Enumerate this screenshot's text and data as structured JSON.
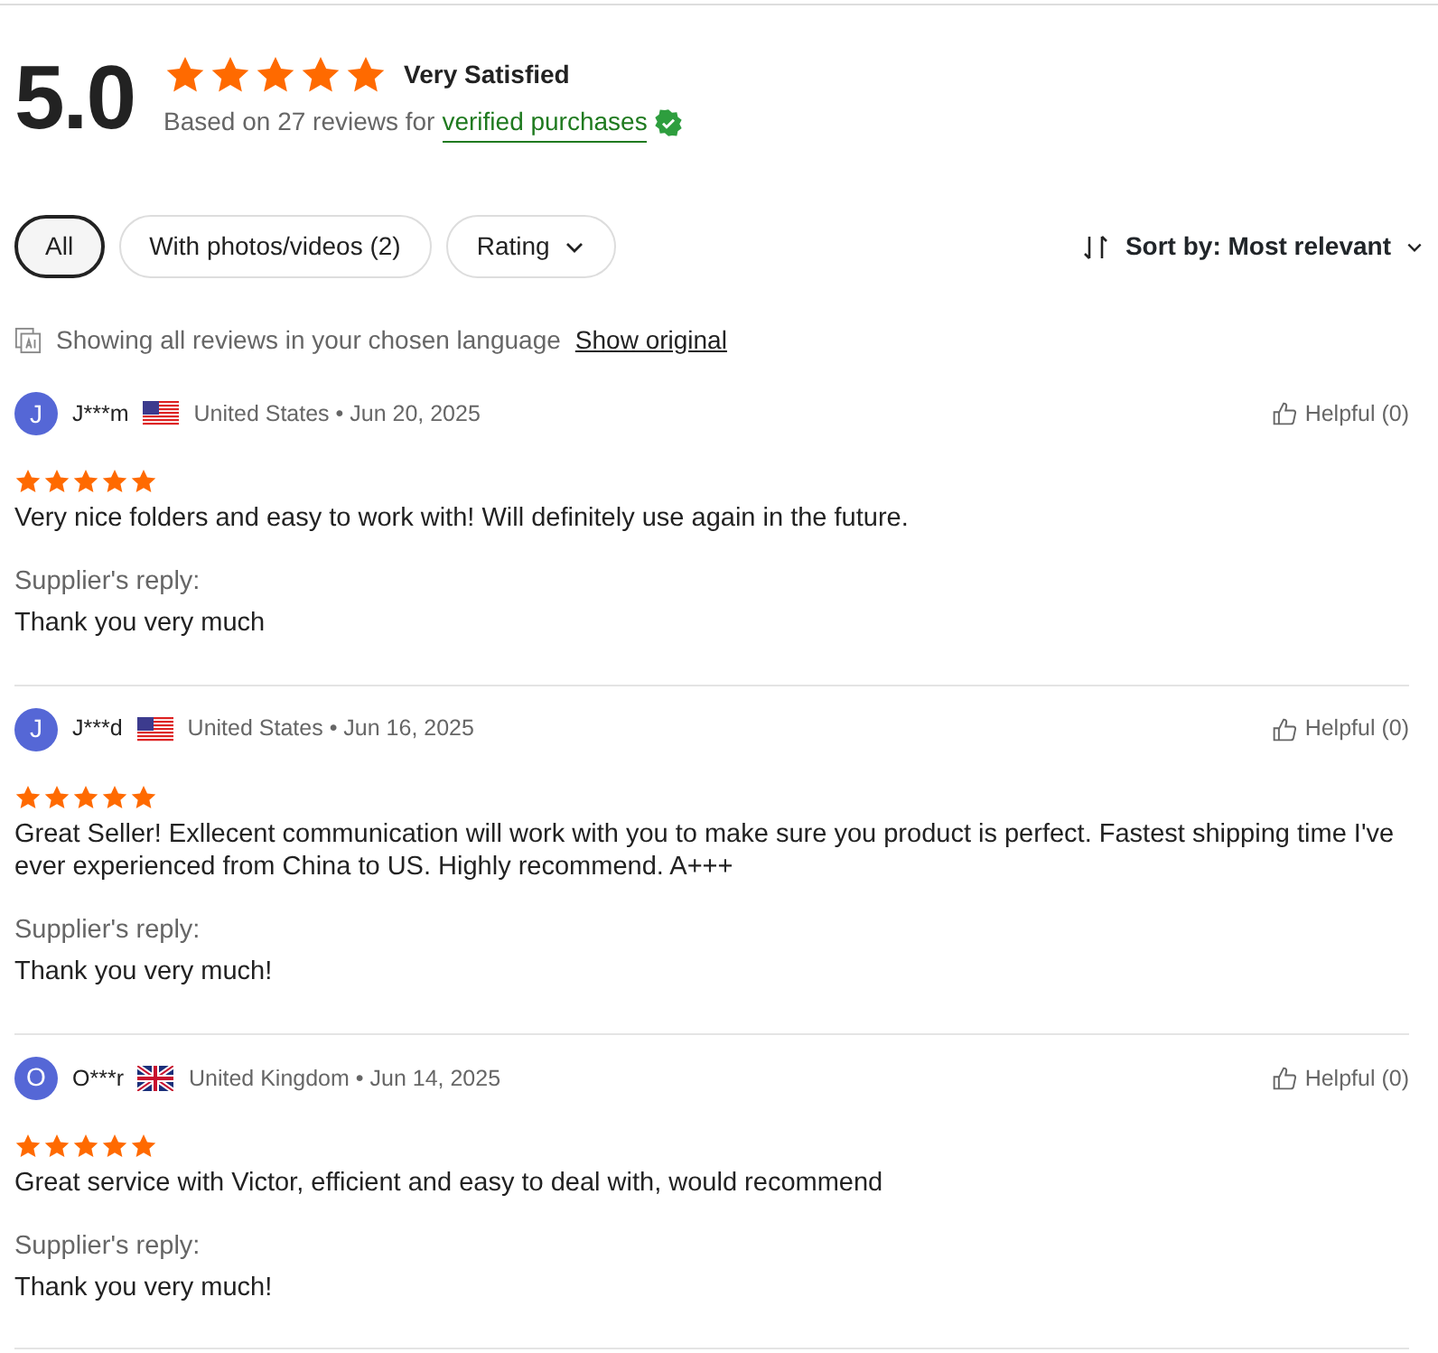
{
  "summary": {
    "score": "5.0",
    "stars": 5,
    "label": "Very Satisfied",
    "based_on": "Based on 27 reviews for",
    "verified_link": "verified purchases"
  },
  "filters": [
    {
      "label": "All",
      "selected": true,
      "kind": "chip"
    },
    {
      "label": "With photos/videos (2)",
      "selected": false,
      "kind": "chip"
    },
    {
      "label": "Rating",
      "selected": false,
      "kind": "dropdown"
    }
  ],
  "sort": {
    "label": "Sort by: Most relevant"
  },
  "translation": {
    "text": "Showing all reviews in your chosen language",
    "link": "Show original"
  },
  "reviews": [
    {
      "initial": "J",
      "name": "J***m",
      "kind": "us",
      "country": "United States",
      "separator": "•",
      "date": "Jun 20, 2025",
      "helpful": "Helpful (0)",
      "stars": 5,
      "text": "Very nice folders and easy to work with! Will definitely use again in the future.",
      "reply_label": "Supplier's reply:",
      "reply": "Thank you very much"
    },
    {
      "initial": "J",
      "name": "J***d",
      "kind": "us",
      "country": "United States",
      "separator": "•",
      "date": "Jun 16, 2025",
      "helpful": "Helpful (0)",
      "stars": 5,
      "text": "Great Seller! Exllecent communication will work with you to make sure you product is perfect. Fastest shipping time I've ever experienced from China to US. Highly recommend. A+++",
      "reply_label": "Supplier's reply:",
      "reply": "Thank you very much!"
    },
    {
      "initial": "O",
      "name": "O***r",
      "kind": "uk",
      "country": "United Kingdom",
      "separator": "•",
      "date": "Jun 14, 2025",
      "helpful": "Helpful (0)",
      "stars": 5,
      "text": "Great service with Victor, efficient and easy to deal with, would recommend",
      "reply_label": "Supplier's reply:",
      "reply": "Thank you very much!"
    }
  ]
}
